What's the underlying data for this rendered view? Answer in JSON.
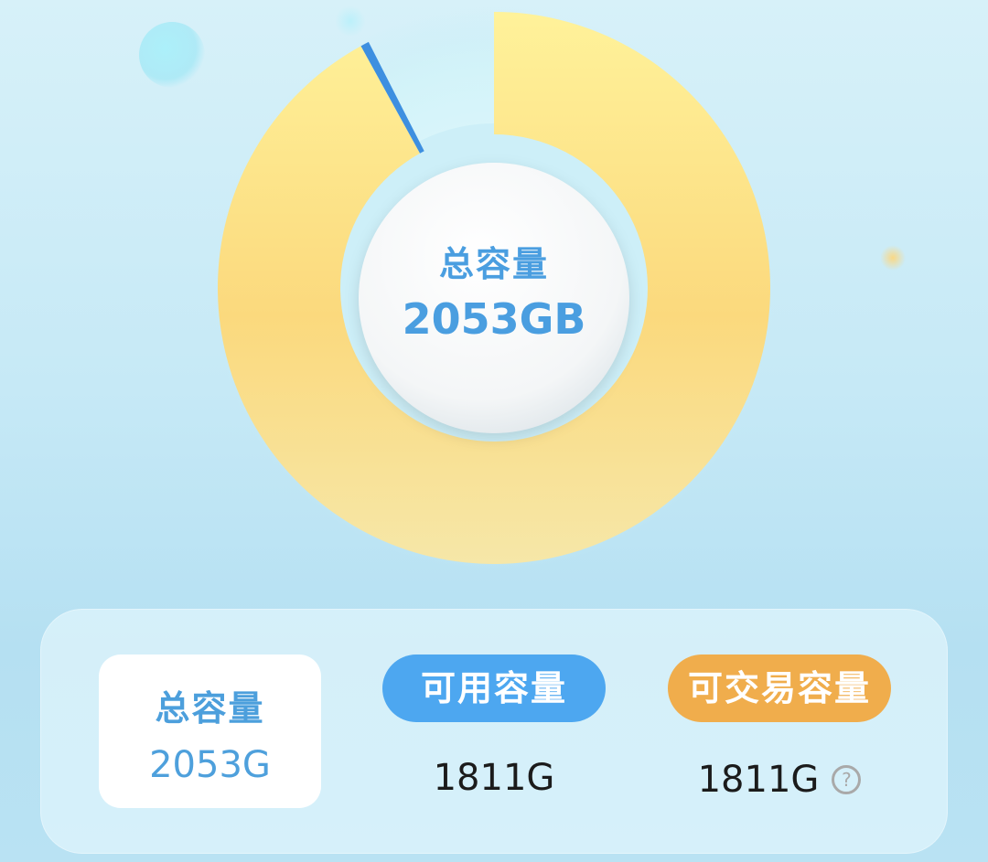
{
  "center": {
    "title": "总容量",
    "value": "2053GB"
  },
  "stats": {
    "total": {
      "label": "总容量",
      "value": "2053G"
    },
    "available": {
      "label": "可用容量",
      "value": "1811G"
    },
    "tradable": {
      "label": "可交易容量",
      "value": "1811G"
    }
  },
  "icons": {
    "help": "help-circle-icon"
  },
  "colors": {
    "tradable_ring": "#f7d77a",
    "used_slice": "#3d8fe0",
    "accent_blue": "#4da7f0",
    "accent_orange": "#f0ad4c"
  },
  "ring": {
    "yellow_fraction": 0.92,
    "blue_fraction": 0.005
  }
}
